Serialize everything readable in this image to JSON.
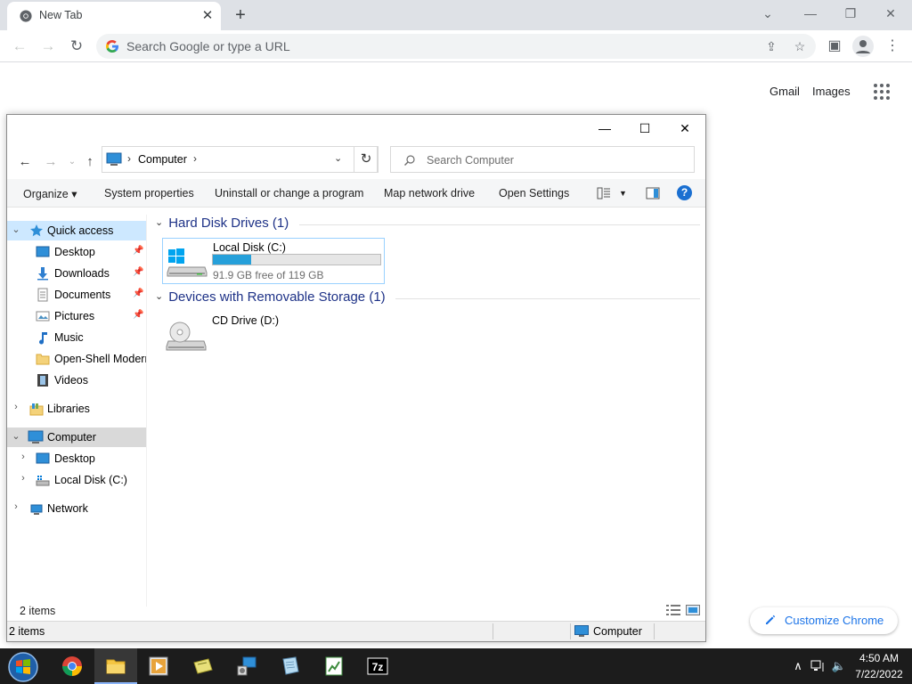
{
  "browser": {
    "tab_title": "New Tab",
    "tab_close": "✕",
    "new_tab": "+",
    "window_controls": {
      "dropdown": "⌄",
      "minimize": "—",
      "restore": "❐",
      "close": "✕"
    },
    "omnibox_placeholder": "Search Google or type a URL",
    "ntp_links": {
      "gmail": "Gmail",
      "images": "Images"
    },
    "customize_label": "Customize Chrome",
    "accent_color": "#1a73e8"
  },
  "explorer": {
    "window_controls": {
      "minimize": "—",
      "maximize": "☐",
      "close": "✕"
    },
    "address": {
      "crumb": "Computer",
      "separator": "›"
    },
    "search_placeholder": "Search Computer",
    "commands": {
      "organize": "Organize ▾",
      "system_properties": "System properties",
      "uninstall": "Uninstall or change a program",
      "map_network": "Map network drive",
      "open_settings": "Open Settings",
      "help": "?"
    },
    "nav": {
      "quick_access": "Quick access",
      "desktop": "Desktop",
      "downloads": "Downloads",
      "documents": "Documents",
      "pictures": "Pictures",
      "music": "Music",
      "open_shell": "Open-Shell Modern",
      "videos": "Videos",
      "libraries": "Libraries",
      "computer": "Computer",
      "computer_desktop": "Desktop",
      "local_disk": "Local Disk (C:)",
      "network": "Network"
    },
    "groups": {
      "hard_disks": "Hard Disk Drives (1)",
      "removable": "Devices with Removable Storage (1)"
    },
    "drives": {
      "c_name": "Local Disk (C:)",
      "c_free": "91.9 GB free of 119 GB",
      "c_used_fraction": 0.228,
      "d_name": "CD Drive (D:)"
    },
    "status_items": "2 items",
    "bottom_items": "2 items",
    "bottom_location": "Computer"
  },
  "taskbar": {
    "clock_time": "4:50 AM",
    "clock_date": "7/22/2022",
    "seven_zip_label": "7z"
  }
}
